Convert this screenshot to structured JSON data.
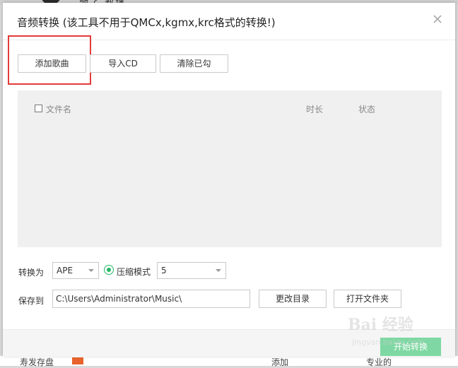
{
  "background": {
    "top_text": "歌子   都播",
    "bottom_left": "寿发存盘",
    "bottom_mid": "添加",
    "bottom_right": "专业的"
  },
  "dialog": {
    "title": "音频转换 (该工具不用于QMCx,kgmx,krc格式的转换!)",
    "buttons": {
      "add_songs": "添加歌曲",
      "import_cd": "导入CD",
      "clear_checked": "清除已勾"
    },
    "list": {
      "columns": {
        "filename": "文件名",
        "duration": "时长",
        "status": "状态"
      }
    },
    "convert": {
      "label": "转换为",
      "format": "APE",
      "mode_label": "压缩模式",
      "level": "5"
    },
    "save": {
      "label": "保存到",
      "path": "C:\\Users\\Administrator\\Music\\",
      "change_dir": "更改目录",
      "open_folder": "打开文件夹"
    },
    "start_button": "开始转换"
  },
  "watermark": {
    "logo": "Bai 经验",
    "url": "jingyan.baidu.com"
  },
  "colors": {
    "accent_green": "#25b864",
    "highlight_red": "#e53b3b",
    "start_button": "#7fd8a3"
  }
}
